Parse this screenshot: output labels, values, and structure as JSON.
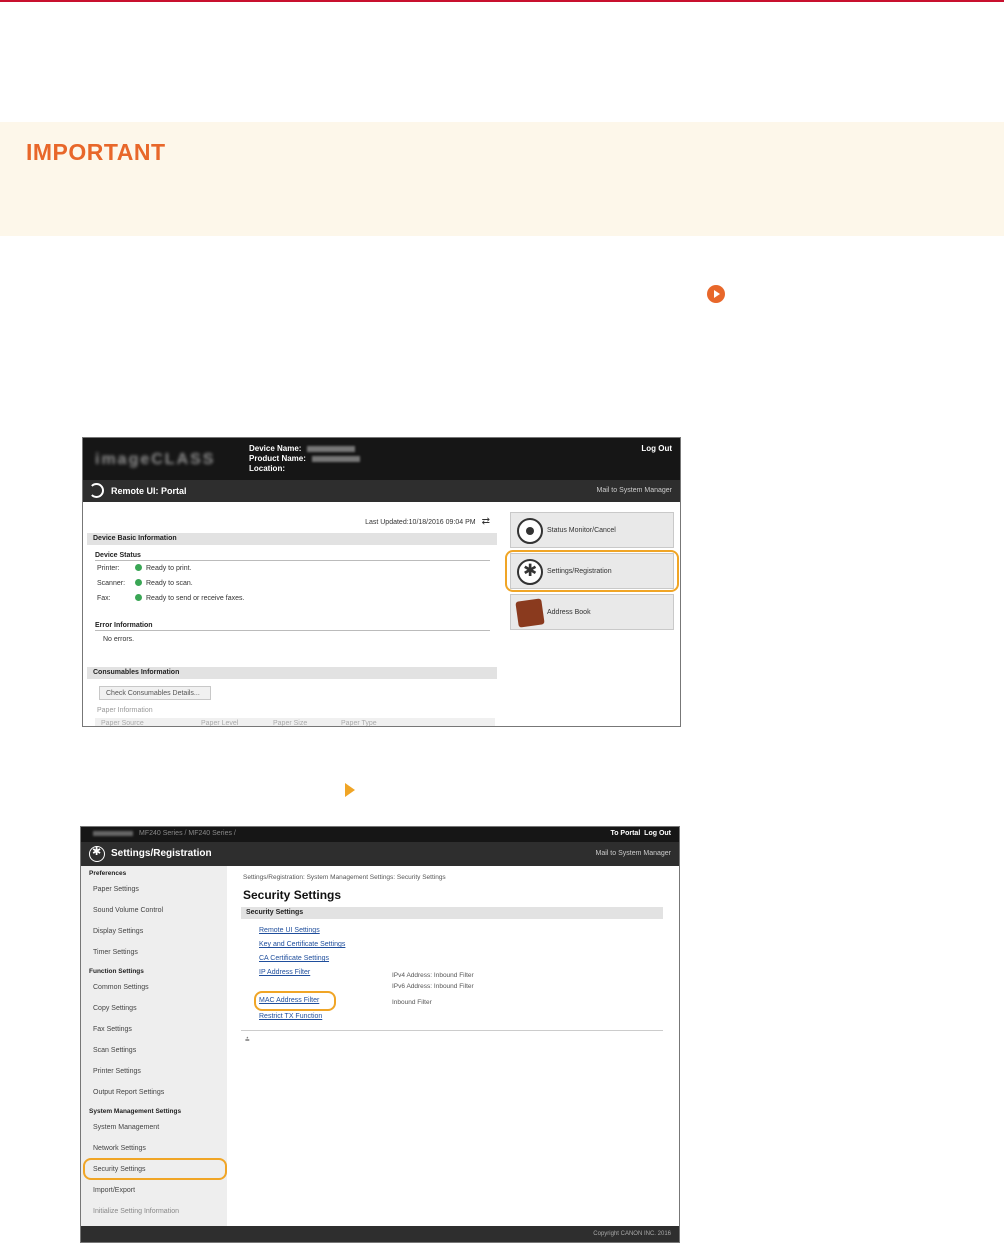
{
  "important": {
    "title": "IMPORTANT"
  },
  "colors": {
    "accent_orange": "#e8672a",
    "highlight": "#f0a526",
    "status_green": "#3aa655",
    "top_rule": "#c8102e"
  },
  "portal": {
    "logo": "imageCLASS",
    "device_name_label": "Device Name:",
    "product_name_label": "Product Name:",
    "location_label": "Location:",
    "logout": "Log Out",
    "title": "Remote UI: Portal",
    "mail": "Mail to System Manager",
    "last_updated": "Last Updated:10/18/2016 09:04 PM",
    "device_basic_info": "Device Basic Information",
    "device_status": "Device Status",
    "status_rows": [
      {
        "label": "Printer:",
        "value": "Ready to print."
      },
      {
        "label": "Scanner:",
        "value": "Ready to scan."
      },
      {
        "label": "Fax:",
        "value": "Ready to send or receive faxes."
      }
    ],
    "error_info": "Error Information",
    "no_errors": "No errors.",
    "consumables_info": "Consumables Information",
    "check_consumables": "Check Consumables Details...",
    "paper_info": "Paper Information",
    "paper_cols": [
      "Paper Source",
      "Paper Level",
      "Paper Size",
      "Paper Type"
    ],
    "tiles": [
      "Status Monitor/Cancel",
      "Settings/Registration",
      "Address Book"
    ]
  },
  "settings": {
    "breadcrumb_suffix": "MF240 Series / MF240 Series /",
    "to_portal": "To Portal",
    "logout": "Log Out",
    "title": "Settings/Registration",
    "mail": "Mail to System Manager",
    "sidebar": {
      "preferences": "Preferences",
      "pref_items": [
        "Paper Settings",
        "Sound Volume Control",
        "Display Settings",
        "Timer Settings"
      ],
      "function": "Function Settings",
      "function_items": [
        "Common Settings",
        "Copy Settings",
        "Fax Settings",
        "Scan Settings",
        "Printer Settings",
        "Output Report Settings"
      ],
      "system": "System Management Settings",
      "system_items": [
        "System Management",
        "Network Settings",
        "Security Settings",
        "Import/Export",
        "Initialize Setting Information"
      ]
    },
    "path": "Settings/Registration: System Management Settings: Security Settings",
    "heading": "Security Settings",
    "section": "Security Settings",
    "links": [
      "Remote UI Settings",
      "Key and Certificate Settings",
      "CA Certificate Settings",
      "IP Address Filter",
      "MAC Address Filter",
      "Restrict TX Function"
    ],
    "ip_desc_1": "IPv4 Address: Inbound Filter",
    "ip_desc_2": "IPv6 Address: Inbound Filter",
    "mac_desc": "Inbound Filter",
    "to_top": "⩮",
    "copyright": "Copyright CANON INC. 2016"
  }
}
